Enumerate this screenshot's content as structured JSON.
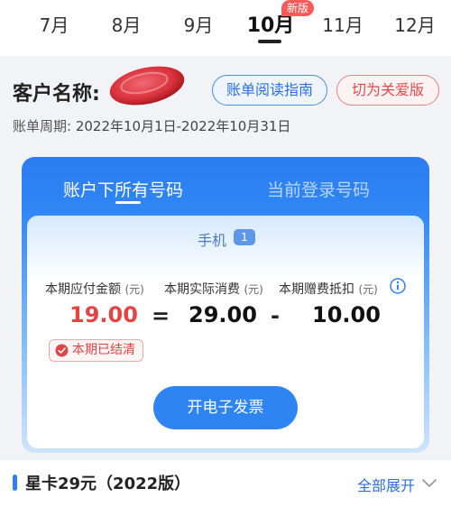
{
  "months": {
    "items": [
      "7月",
      "8月",
      "9月",
      "10月",
      "11月",
      "12月"
    ],
    "active_index": 3,
    "new_badge": "新版"
  },
  "header": {
    "customer_label": "客户名称:",
    "guide_button": "账单阅读指南",
    "care_button": "切为关爱版",
    "period_label": "账单周期:",
    "period_value": "2022年10月1日-2022年10月31日"
  },
  "card": {
    "tab_active": "账户下所有号码",
    "tab_inactive": "当前登录号码",
    "phone_label": "手机",
    "phone_count": "1",
    "labels": {
      "due": "本期应付金额",
      "actual": "本期实际消费",
      "gift": "本期赠费抵扣",
      "unit": "(元)"
    },
    "values": {
      "due": "19.00",
      "actual": "29.00",
      "gift": "10.00",
      "equals": "=",
      "minus": "-"
    },
    "status": "本期已结清",
    "invoice_button": "开电子发票"
  },
  "plan": {
    "title": "星卡29元（2022版）",
    "expand_label": "全部展开"
  },
  "colors": {
    "accent": "#2f84f3",
    "due_red": "#e34545"
  }
}
